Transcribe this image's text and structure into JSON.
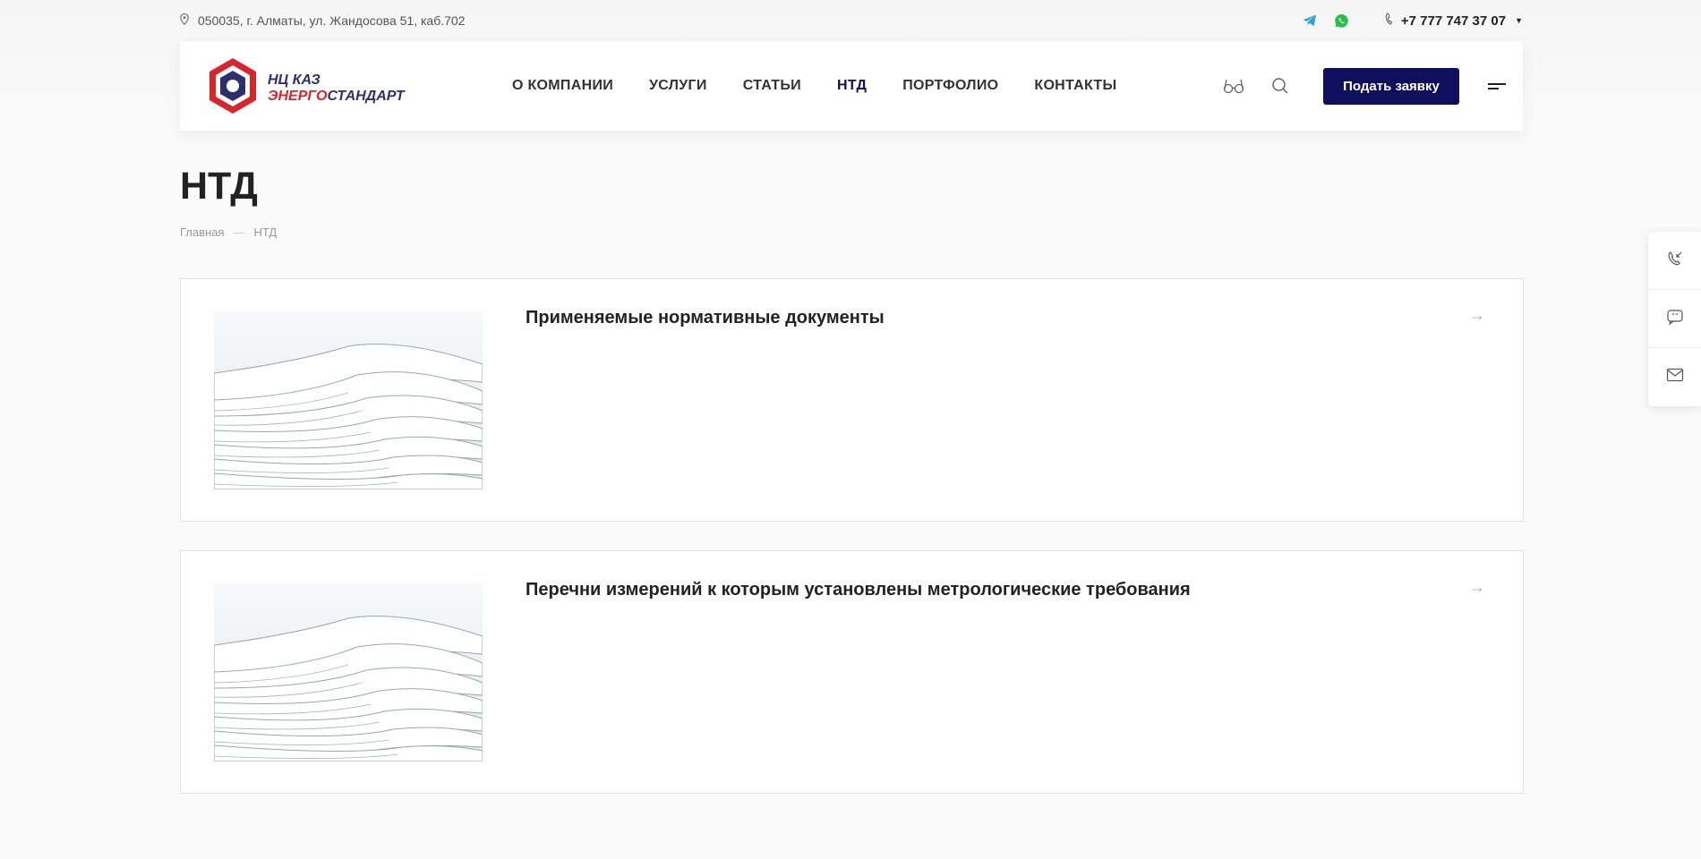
{
  "topbar": {
    "address": "050035, г. Алматы, ул. Жандосова 51, каб.702",
    "phone": "+7 777 747 37 07"
  },
  "logo": {
    "line1": "НЦ КАЗ",
    "line2_red": "ЭНЕРГО",
    "line2_blue": "СТАНДАРТ"
  },
  "nav": {
    "items": [
      {
        "label": "О КОМПАНИИ"
      },
      {
        "label": "УСЛУГИ"
      },
      {
        "label": "СТАТЬИ"
      },
      {
        "label": "НТД"
      },
      {
        "label": "ПОРТФОЛИО"
      },
      {
        "label": "КОНТАКТЫ"
      }
    ],
    "active": "НТД"
  },
  "header": {
    "cta_label": "Подать заявку"
  },
  "page": {
    "title": "НТД",
    "breadcrumbs": [
      "Главная",
      "НТД"
    ],
    "breadcrumb_separator": "—"
  },
  "cards": [
    {
      "title": "Применяемые нормативные документы",
      "arrow": "→"
    },
    {
      "title": "Перечни измерений к которым установлены метрологические требования",
      "arrow": "→"
    }
  ],
  "colors": {
    "brand_navy": "#0f0f5e",
    "brand_red": "#d8252b",
    "telegram": "#2aa3e0",
    "whatsapp": "#27c04a"
  }
}
